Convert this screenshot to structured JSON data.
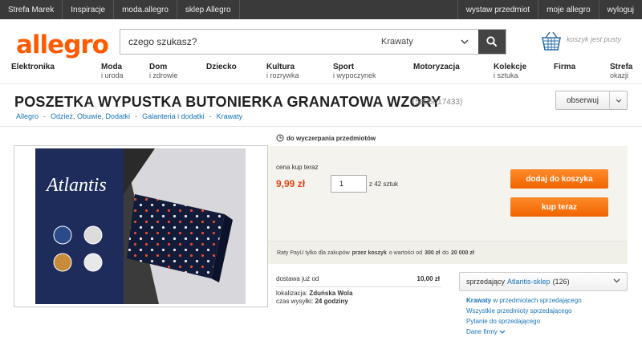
{
  "topbar": {
    "left": [
      "Strefa Marek",
      "Inspiracje",
      "moda.allegro",
      "sklep Allegro"
    ],
    "right": [
      "wystaw przedmiot",
      "moje allegro",
      "wyloguj"
    ]
  },
  "header": {
    "logo": "allegro",
    "search_placeholder": "czego szukasz?",
    "category": "Krawaty",
    "cart_text": "koszyk jest pusty"
  },
  "nav": [
    {
      "title": "Elektronika",
      "sub": ""
    },
    {
      "title": "Moda",
      "sub": "i uroda"
    },
    {
      "title": "Dom",
      "sub": "i zdrowie"
    },
    {
      "title": "Dziecko",
      "sub": ""
    },
    {
      "title": "Kultura",
      "sub": "i rozrywka"
    },
    {
      "title": "Sport",
      "sub": "i wypoczynek"
    },
    {
      "title": "Motoryzacja",
      "sub": ""
    },
    {
      "title": "Kolekcje",
      "sub": "i sztuka"
    },
    {
      "title": "Firma",
      "sub": ""
    },
    {
      "title": "Strefa",
      "sub": "okazji"
    }
  ],
  "product": {
    "title": "POSZETKA WYPUSTKA BUTONIERKA GRANATOWA WZORY",
    "id": "(5805017433)",
    "observe_label": "obserwuj",
    "breadcrumbs": [
      "Allegro",
      "Odzież, Obuwie, Dodatki",
      "Galanteria i dodatki",
      "Krawaty"
    ],
    "image_brand": "Atlantis",
    "stock_note": "do wyczerpania przedmiotów",
    "price_label": "cena kup teraz",
    "price": "9,99 zł",
    "quantity": "1",
    "quantity_of": "z 42 sztuk",
    "add_to_cart": "dodaj do koszyka",
    "buy_now": "kup teraz",
    "payu": {
      "p1": "Raty PayU tylko dla zakupów",
      "b1": "przez koszyk",
      "p2": "o wartości od",
      "b2": "300 zł",
      "p3": "do",
      "b3": "20 000 zł"
    },
    "shipping": {
      "label": "dostawa już od",
      "value": "10,00 zł",
      "location_label": "lokalizacja:",
      "location": "Zduńska Wola",
      "time_label": "czas wysyłki:",
      "time": "24 godziny"
    }
  },
  "seller": {
    "label": "sprzedający",
    "name": "Atlantis-sklep",
    "count": "(126)",
    "links": {
      "krawaty": "Krawaty",
      "krawaty_suffix": "w przedmiotach sprzedającego",
      "all": "Wszystkie przedmioty sprzedającego",
      "ask": "Pytanie do sprzedającego",
      "company": "Dane firmy"
    }
  },
  "colors": {
    "accent": "#ff5a00",
    "link": "#1a74b8",
    "topbar": "#3a3a3a",
    "price": "#e2461a"
  }
}
